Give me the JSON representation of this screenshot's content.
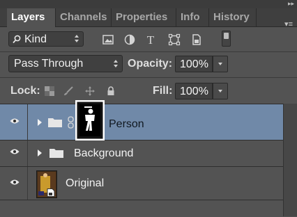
{
  "tabs": [
    {
      "label": "Layers",
      "active": true
    },
    {
      "label": "Channels",
      "active": false
    },
    {
      "label": "Properties",
      "active": false
    },
    {
      "label": "Info",
      "active": false
    },
    {
      "label": "History",
      "active": false
    }
  ],
  "panel": {
    "collapse_icon": "double-chevron-right-icon",
    "menu_icon": "panel-menu-icon"
  },
  "filter": {
    "kind_label": "Kind",
    "icons": [
      "pixel-filter-icon",
      "adjustment-filter-icon",
      "type-filter-icon",
      "shape-filter-icon",
      "smart-object-filter-icon"
    ],
    "type_glyph": "T"
  },
  "blend": {
    "mode": "Pass Through",
    "opacity_label": "Opacity:",
    "opacity_value": "100%"
  },
  "lock": {
    "label": "Lock:",
    "fill_label": "Fill:",
    "fill_value": "100%"
  },
  "layers": [
    {
      "name": "Person",
      "selected": true,
      "type": "group",
      "has_mask": true
    },
    {
      "name": "Background",
      "selected": false,
      "type": "group"
    },
    {
      "name": "Original",
      "selected": false,
      "type": "smart-object"
    }
  ],
  "colors": {
    "panel_bg": "#535353",
    "selected_row": "#7089a8",
    "tab_bar": "#3f3f3f"
  }
}
